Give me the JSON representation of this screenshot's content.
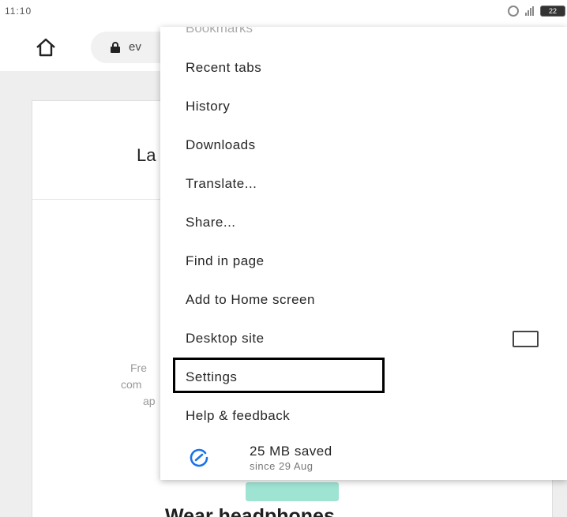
{
  "status_bar": {
    "time": "11:10",
    "battery": "22"
  },
  "toolbar": {
    "url_text": "ev"
  },
  "page": {
    "card_title": "La",
    "text_line_1": "Fre",
    "text_line_2": "com",
    "text_line_3": "ap",
    "heading": "Wear headphones"
  },
  "menu": {
    "partial_item": "Bookmarks",
    "items": [
      {
        "label": "Recent tabs"
      },
      {
        "label": "History"
      },
      {
        "label": "Downloads"
      },
      {
        "label": "Translate..."
      },
      {
        "label": "Share..."
      },
      {
        "label": "Find in page"
      },
      {
        "label": "Add to Home screen"
      },
      {
        "label": "Desktop site",
        "checkbox": false
      },
      {
        "label": "Settings",
        "highlighted": true
      },
      {
        "label": "Help & feedback"
      }
    ],
    "savings": {
      "title": "25 MB saved",
      "subtitle": "since 29 Aug",
      "icon": "data-saver-gauge-icon",
      "icon_color": "#1a73e8"
    }
  }
}
